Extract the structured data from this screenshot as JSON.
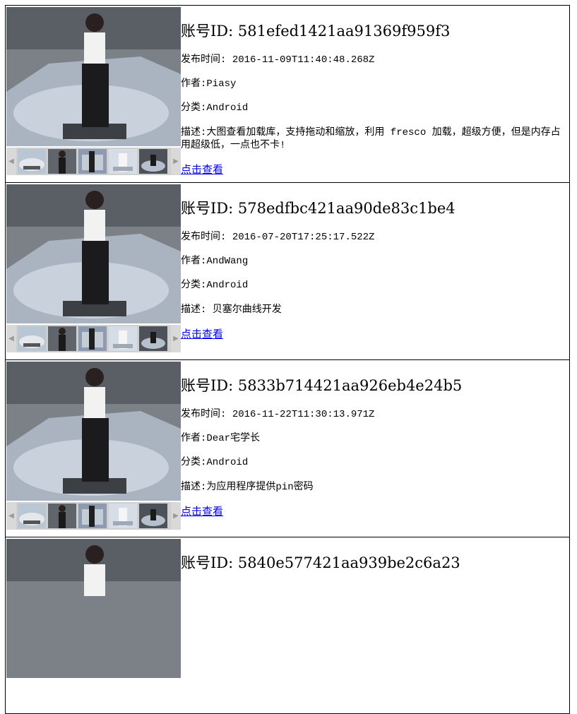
{
  "labels": {
    "id_prefix": "账号ID:",
    "published": "发布时间:",
    "author": "作者:",
    "category": "分类:",
    "description": "描述:",
    "view_link": "点击查看"
  },
  "items": [
    {
      "id": "581efed1421aa91369f959f3",
      "published": "2016-11-09T11:40:48.268Z",
      "author": "Piasy",
      "category": "Android",
      "description": "大图查看加载库，支持拖动和缩放，利用 fresco 加载，超级方便，但是内存占用超级低，一点也不卡!"
    },
    {
      "id": "578edfbc421aa90de83c1be4",
      "published": "2016-07-20T17:25:17.522Z",
      "author": "AndWang",
      "category": "Android",
      "description": " 贝塞尔曲线开发"
    },
    {
      "id": "5833b714421aa926eb4e24b5",
      "published": "2016-11-22T11:30:13.971Z",
      "author": "Dear宅学长",
      "category": "Android",
      "description": "为应用程序提供pin密码"
    },
    {
      "id": "5840e577421aa939be2c6a23",
      "published": "",
      "author": "",
      "category": "",
      "description": ""
    }
  ],
  "icons": {
    "prev": "chevron-left-icon",
    "next": "chevron-right-icon"
  },
  "colors": {
    "link": "#0000ee",
    "border": "#000000"
  }
}
